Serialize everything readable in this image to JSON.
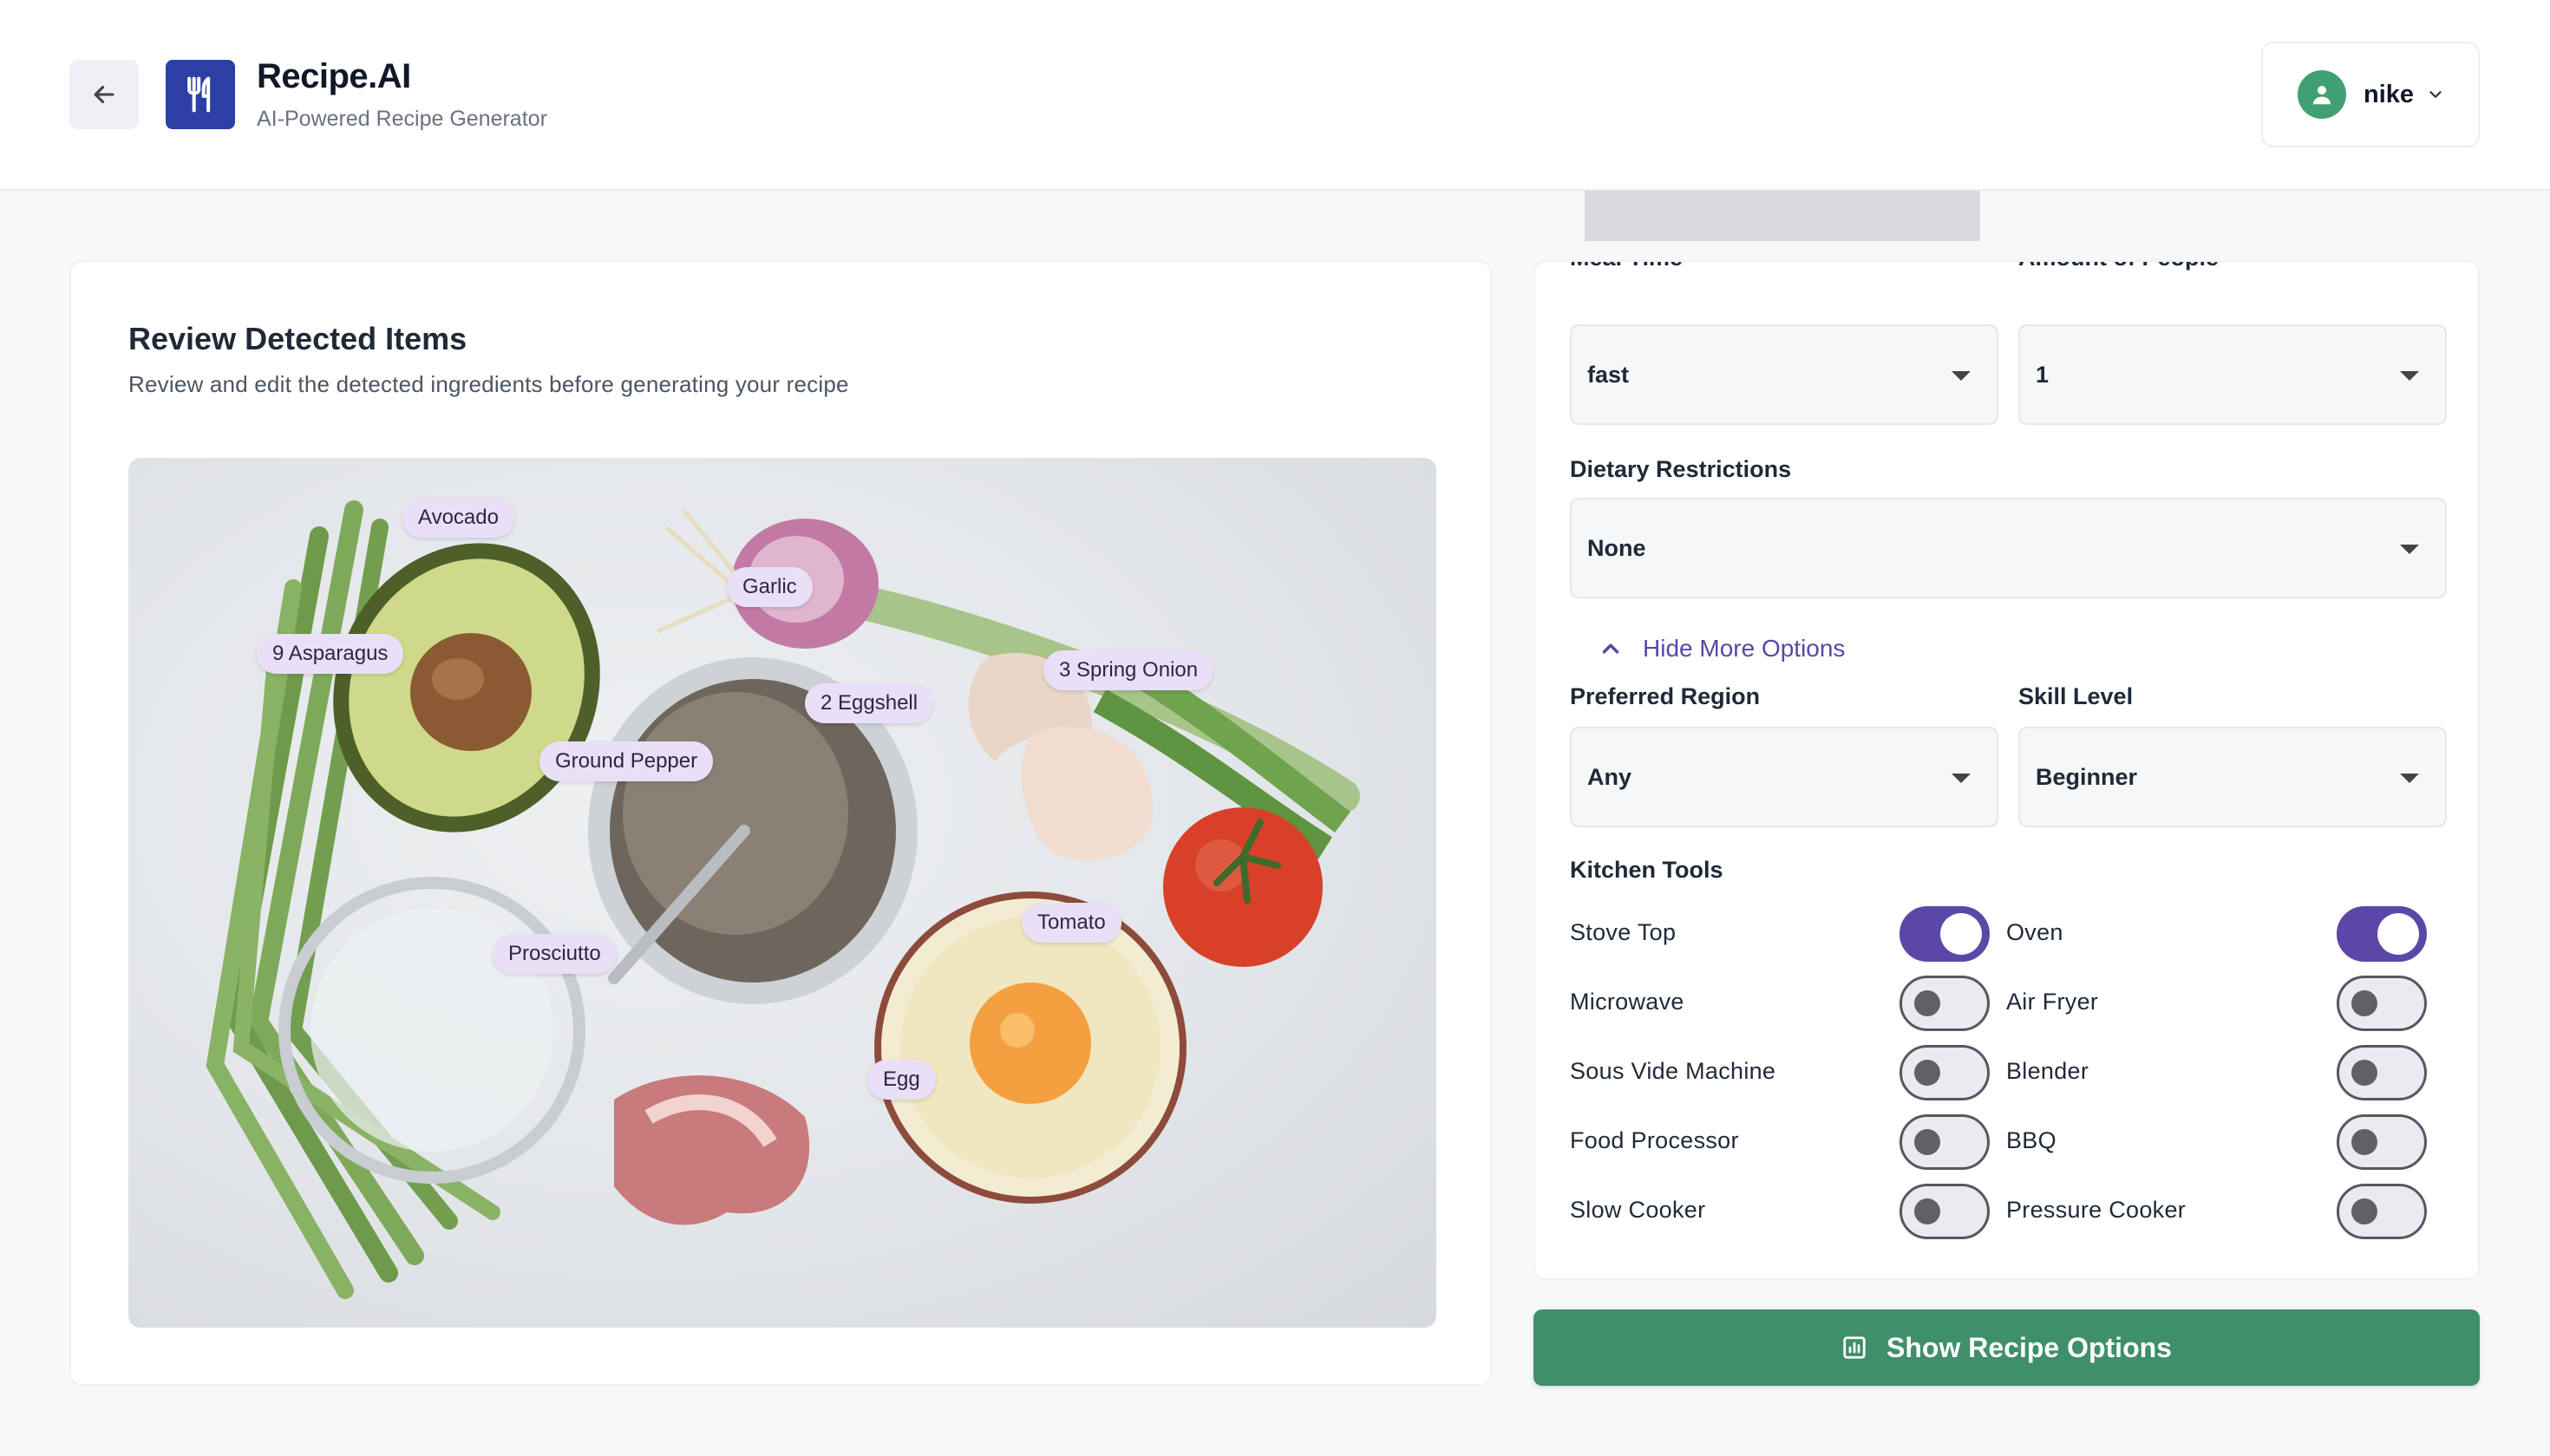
{
  "header": {
    "app_title": "Recipe.AI",
    "app_subtitle": "AI-Powered Recipe Generator",
    "user_name": "nike"
  },
  "review": {
    "title": "Review Detected Items",
    "description": "Review and edit the detected ingredients before generating your recipe",
    "tags": [
      "Avocado",
      "Garlic",
      "9 Asparagus",
      "3 Spring Onion",
      "2 Eggshell",
      "Ground Pepper",
      "Tomato",
      "Prosciutto",
      "Egg"
    ]
  },
  "options": {
    "meal_time_label": "Meal Time",
    "meal_time_value": "fast",
    "people_label": "Amount of People",
    "people_value": "1",
    "dietary_label": "Dietary Restrictions",
    "dietary_value": "None",
    "toggle_more_label": "Hide More Options",
    "region_label": "Preferred Region",
    "region_value": "Any",
    "skill_label": "Skill Level",
    "skill_value": "Beginner",
    "kitchen_tools_label": "Kitchen Tools",
    "tools": [
      {
        "label": "Stove Top",
        "on": true
      },
      {
        "label": "Oven",
        "on": true
      },
      {
        "label": "Microwave",
        "on": false
      },
      {
        "label": "Air Fryer",
        "on": false
      },
      {
        "label": "Sous Vide Machine",
        "on": false
      },
      {
        "label": "Blender",
        "on": false
      },
      {
        "label": "Food Processor",
        "on": false
      },
      {
        "label": "BBQ",
        "on": false
      },
      {
        "label": "Slow Cooker",
        "on": false
      },
      {
        "label": "Pressure Cooker",
        "on": false
      }
    ]
  },
  "cta": {
    "label": "Show Recipe Options",
    "icon": "chart-icon"
  },
  "colors": {
    "brand": "#2c3fa5",
    "accent": "#5b47a8",
    "cta": "#3f8f6a",
    "avatar": "#40a073"
  }
}
